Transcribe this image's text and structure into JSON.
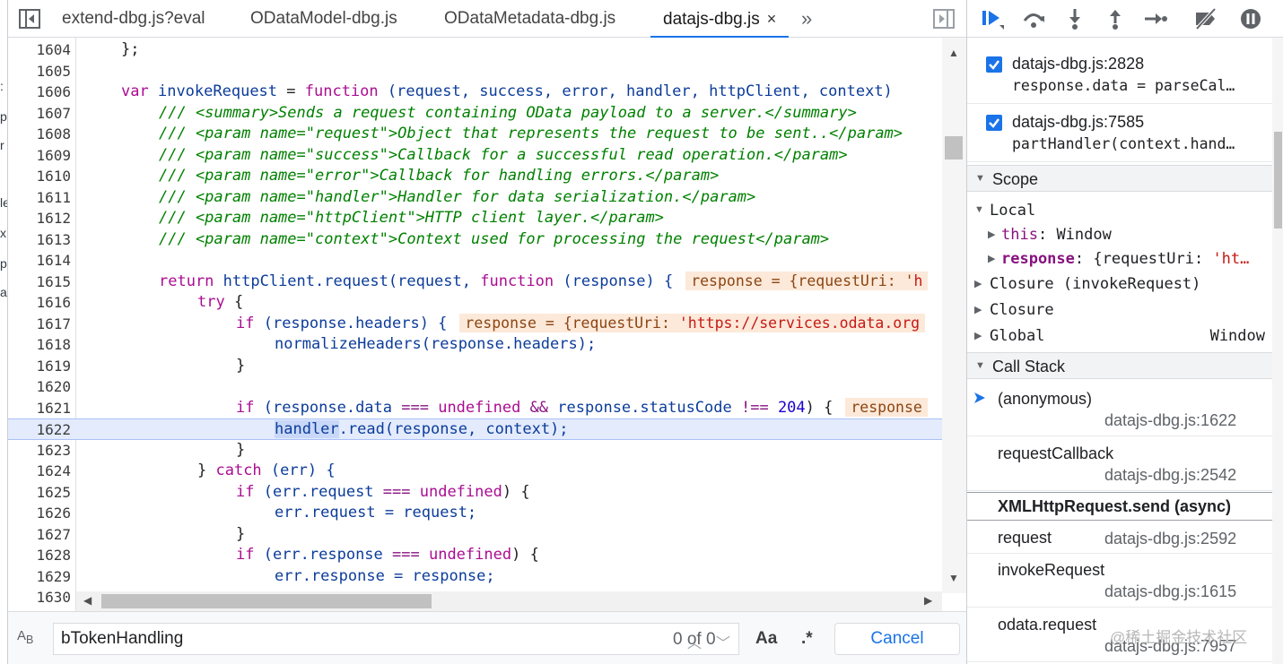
{
  "tabs": [
    {
      "label": "extend-dbg.js?eval"
    },
    {
      "label": "ODataModel-dbg.js"
    },
    {
      "label": "ODataMetadata-dbg.js"
    },
    {
      "label": "datajs-dbg.js",
      "close": "×"
    }
  ],
  "tab_overflow": "»",
  "code": {
    "lines": [
      {
        "n": "1604"
      },
      {
        "n": "1605"
      },
      {
        "n": "1606"
      },
      {
        "n": "1607"
      },
      {
        "n": "1608"
      },
      {
        "n": "1609"
      },
      {
        "n": "1610"
      },
      {
        "n": "1611"
      },
      {
        "n": "1612"
      },
      {
        "n": "1613"
      },
      {
        "n": "1614"
      },
      {
        "n": "1615"
      },
      {
        "n": "1616"
      },
      {
        "n": "1617"
      },
      {
        "n": "1618"
      },
      {
        "n": "1619"
      },
      {
        "n": "1620"
      },
      {
        "n": "1621"
      },
      {
        "n": "1622"
      },
      {
        "n": "1623"
      },
      {
        "n": "1624"
      },
      {
        "n": "1625"
      },
      {
        "n": "1626"
      },
      {
        "n": "1627"
      },
      {
        "n": "1628"
      },
      {
        "n": "1629"
      },
      {
        "n": "1630"
      }
    ],
    "text": {
      "l1604": "};",
      "l1606_kw": "var",
      "l1606_name": "invokeRequest",
      "l1606_eq": " = ",
      "l1606_fn": "function",
      "l1606_params": " (request, success, error, handler, httpClient, context)",
      "l1607": "/// <summary>Sends a request containing OData payload to a server.</summary>",
      "l1608": "/// <param name=\"request\">Object that represents the request to be sent..</param>",
      "l1609": "/// <param name=\"success\">Callback for a successful read operation.</param>",
      "l1610": "/// <param name=\"error\">Callback for handling errors.</param>",
      "l1611": "/// <param name=\"handler\">Handler for data serialization.</param>",
      "l1612": "/// <param name=\"httpClient\">HTTP client layer.</param>",
      "l1613": "/// <param name=\"context\">Context used for processing the request</param>",
      "l1615_ret": "return",
      "l1615_a": " httpClient.request(request, ",
      "l1615_fn": "function",
      "l1615_b": " (response) {",
      "l1615_inline": "response = {requestUri: '",
      "l1615_inline_str": "h",
      "l1616_try": "try",
      "l1616_b": " {",
      "l1617_if": "if",
      "l1617_a": " (response.headers) {",
      "l1617_inline": "response = {requestUri: ",
      "l1617_inline_str": "'https://services.odata.org",
      "l1618": "normalizeHeaders(response.headers);",
      "l1619": "}",
      "l1621_if": "if",
      "l1621_a": " (response.data ",
      "l1621_op1": "===",
      "l1621_undef": " undefined",
      "l1621_and": " &&",
      "l1621_b": " response.statusCode ",
      "l1621_op2": "!==",
      "l1621_num": " 204",
      "l1621_c": ") {",
      "l1621_inline": "response",
      "l1622_hl": "handler",
      "l1622_rest": ".read(response, context);",
      "l1623": "}",
      "l1624_a": "} ",
      "l1624_catch": "catch",
      "l1624_b": " (err) {",
      "l1625_if": "if",
      "l1625_a": " (err.request ",
      "l1625_op": "===",
      "l1625_undef": " undefined",
      "l1625_b": ") {",
      "l1626": "err.request = request;",
      "l1627": "}",
      "l1628_if": "if",
      "l1628_a": " (err.response ",
      "l1628_op": "===",
      "l1628_undef": " undefined",
      "l1628_b": ") {",
      "l1629": "err.response = response;"
    }
  },
  "search": {
    "value": "bTokenHandling",
    "match_count": "0 of 0",
    "match_case": "Aa",
    "regex": ".*",
    "cancel_label": "Cancel"
  },
  "sidebar": {
    "breakpoints": [
      {
        "file": "datajs-dbg.js:2828",
        "code": "response.data = parseCal…",
        "checked": true
      },
      {
        "file": "datajs-dbg.js:7585",
        "code": "partHandler(context.hand…",
        "checked": true
      }
    ],
    "scope": {
      "title": "Scope",
      "local_label": "Local",
      "this_name": "this",
      "this_value": "Window",
      "response_name": "response",
      "response_value": "{requestUri: ",
      "response_value_str": "'ht…",
      "closure1": "Closure (invokeRequest)",
      "closure2": "Closure",
      "global_label": "Global",
      "global_value": "Window"
    },
    "call_stack": {
      "title": "Call Stack",
      "frames": [
        {
          "fn": "(anonymous)",
          "loc": "datajs-dbg.js:1622"
        },
        {
          "fn": "requestCallback",
          "loc": "datajs-dbg.js:2542"
        },
        {
          "fn": "request",
          "loc": "datajs-dbg.js:2592"
        },
        {
          "fn": "invokeRequest",
          "loc": "datajs-dbg.js:1615"
        },
        {
          "fn": "odata.request",
          "loc": "datajs-dbg.js:7957"
        }
      ],
      "async_label": "XMLHttpRequest.send (async)"
    }
  },
  "watermark": "@稀土掘金技术社区",
  "colors": {
    "accent": "#1a73e8",
    "current_line": "#e3ebfd",
    "inline_value_bg": "#fde9d9"
  }
}
